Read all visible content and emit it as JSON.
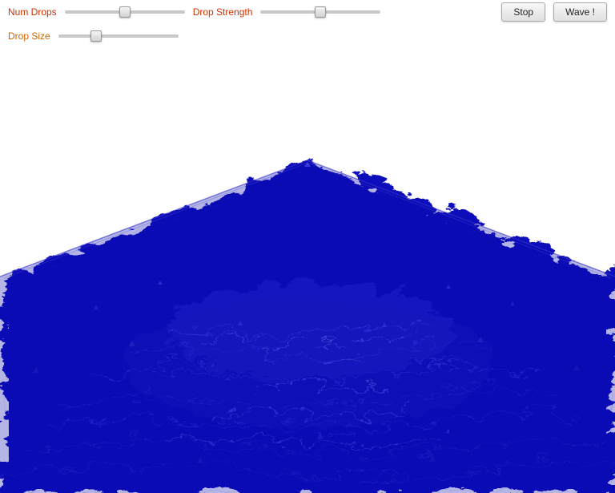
{
  "controls": {
    "num_drops_label": "Num Drops",
    "drop_size_label": "Drop Size",
    "drop_strength_label": "Drop Strength",
    "num_drops_value": 50,
    "drop_size_value": 30,
    "drop_strength_value": 50,
    "stop_button_label": "Stop",
    "wave_button_label": "Wave !"
  },
  "water": {
    "description": "3D water ripple simulation"
  }
}
